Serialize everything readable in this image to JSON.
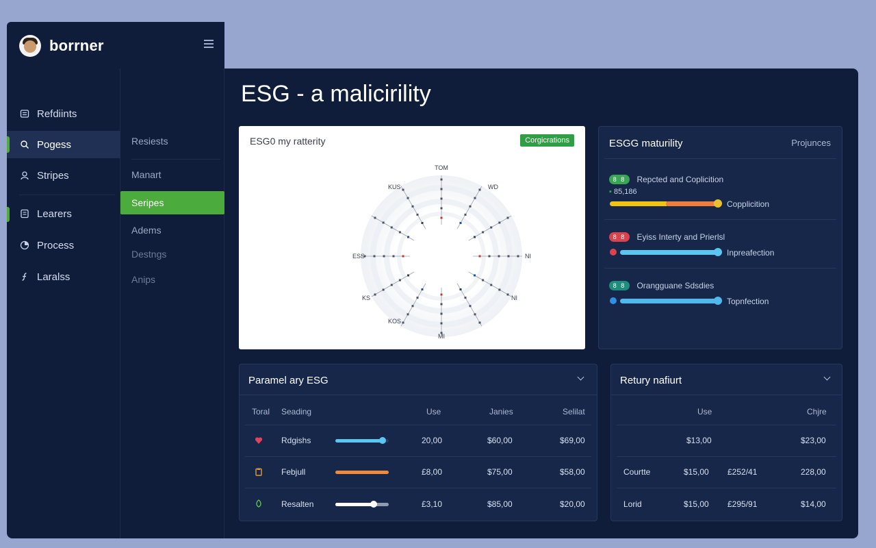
{
  "brand": {
    "name": "borrner"
  },
  "sidebar": {
    "items": [
      {
        "label": "Refdiints",
        "icon": "list-icon"
      },
      {
        "label": "Pogess",
        "icon": "search-icon"
      },
      {
        "label": "Stripes",
        "icon": "user-icon"
      },
      {
        "label": "Learers",
        "icon": "document-icon"
      },
      {
        "label": "Process",
        "icon": "chart-icon"
      },
      {
        "label": "Laralss",
        "icon": "function-icon"
      }
    ],
    "active_index": 1
  },
  "subnav": {
    "items": [
      "Resiests",
      "Manart",
      "Seripes",
      "Adems",
      "Destngs",
      "Anips"
    ],
    "active_index": 2
  },
  "page": {
    "title": "ESG - a malicirility"
  },
  "radial_card": {
    "title": "ESG0 my ratterity",
    "badge": "Corgicrations",
    "labels": {
      "top": "TOM",
      "bottom": "MI",
      "left": "ESS",
      "right": "NI",
      "tl": "KUS",
      "tr": "WD",
      "bl": "KS",
      "br": "NI",
      "bl2": "KOS"
    }
  },
  "maturity": {
    "title": "ESGG maturility",
    "right_label": "Projunces",
    "rows": [
      {
        "pill_text": "8 8",
        "pill_color": "#3aa655",
        "title": "Repcted and Coplicition",
        "sub": "85,186",
        "bar_label": "Copplicition",
        "progress": 1.0,
        "colors": [
          "#f1c40f",
          "#ef7d3c",
          "#e8c12f"
        ]
      },
      {
        "pill_text": "8 8",
        "pill_color": "#d9434e",
        "title": "Eyiss Interty and Prierlsl",
        "bar_label": "Inpreafection",
        "progress": 1.0,
        "colors": [
          "#5bc6ef"
        ]
      },
      {
        "pill_text": "8 8",
        "pill_color": "#1f8d7c",
        "title": "Orangguane Sdsdies",
        "bar_label": "Topnfection",
        "progress": 1.0,
        "colors": [
          "#4fb8ec"
        ]
      }
    ]
  },
  "param_table": {
    "title": "Paramel ary ESG",
    "headers": [
      "Toral",
      "Seading",
      "Use",
      "Janies",
      "Selilat"
    ],
    "rows": [
      {
        "icon": "heart-icon",
        "name": "Rdgishs",
        "bar_color": "#5bc6ef",
        "level": 0.88,
        "use": "20,00",
        "janies": "$60,00",
        "selilat": "$69,00"
      },
      {
        "icon": "clipboard-icon",
        "name": "Febjull",
        "bar_color": "#ef8a3c",
        "level": 1.0,
        "use": "£8,00",
        "janies": "$75,00",
        "selilat": "$58,00"
      },
      {
        "icon": "leaf-icon",
        "name": "Resalten",
        "bar_color": "#ffffff",
        "level": 0.72,
        "use": "£3,10",
        "janies": "$85,00",
        "selilat": "$20,00"
      }
    ]
  },
  "retury_table": {
    "title": "Retury nafiurt",
    "headers": [
      "Use",
      "Chjre"
    ],
    "rows": [
      {
        "name": "",
        "use": "$13,00",
        "mid": "",
        "chjre": "$23,00"
      },
      {
        "name": "Courtte",
        "use": "$15,00",
        "mid": "£252/41",
        "chjre": "228,00"
      },
      {
        "name": "Lorid",
        "use": "$15,00",
        "mid": "£295/91",
        "chjre": "$14,00"
      }
    ]
  }
}
